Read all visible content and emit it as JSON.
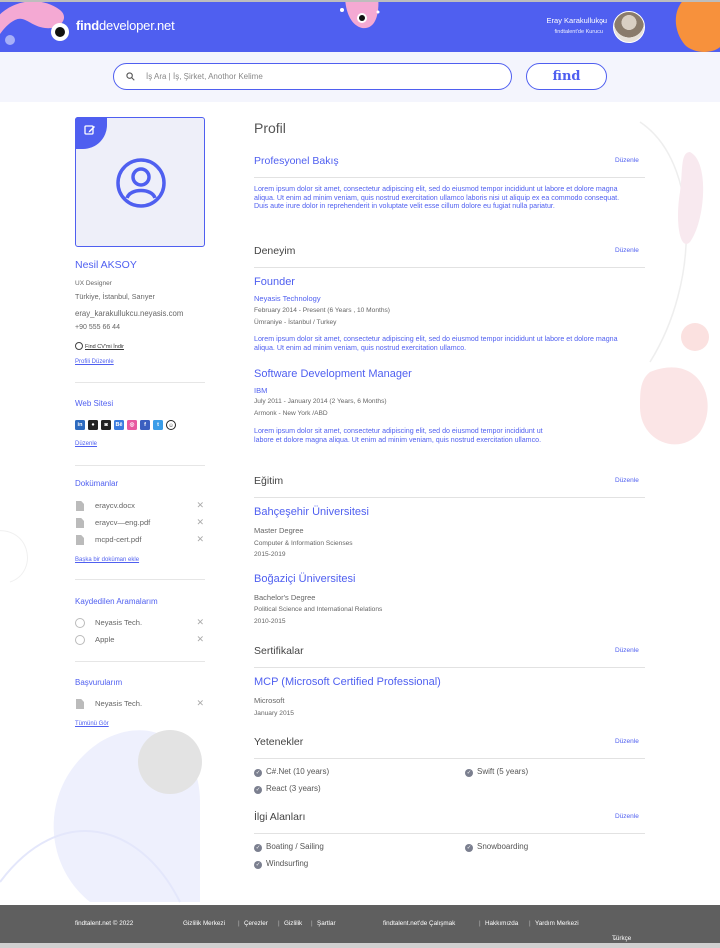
{
  "brand": {
    "logo_find": "find",
    "logo_rest": "developer.net"
  },
  "user": {
    "name": "Eray Karakullukçu",
    "subtitle": "findtalent'de Kurucu"
  },
  "search": {
    "placeholder": "İş Ara  |  İş, Şirket, Anothor Kelime",
    "button": "find"
  },
  "profile": {
    "name": "Nesil AKSOY",
    "title": "UX Designer",
    "location": "Türkiye, İstanbul, Sarıyer",
    "email": "eray_karakullukcu.neyasis.com",
    "phone": "+90 555 66 44",
    "cv_link": "Find CV'mi İndir",
    "edit_link": "Profili Düzenle"
  },
  "website": {
    "heading": "Web Sitesi",
    "icons": [
      "linkedin-icon",
      "github-icon",
      "dribbble-icon",
      "behance-icon",
      "instagram-icon",
      "facebook-icon",
      "twitter-icon",
      "reddit-icon"
    ],
    "edit": "Düzenle"
  },
  "documents": {
    "heading": "Dokümanlar",
    "items": [
      "eraycv.docx",
      "eraycv—eng.pdf",
      "mcpd-cert.pdf"
    ],
    "add_link": "Başka bir doküman ekle"
  },
  "saved_searches": {
    "heading": "Kaydedilen Aramalarım",
    "items": [
      "Neyasis Tech.",
      "Apple"
    ]
  },
  "applications": {
    "heading": "Başvurularım",
    "items": [
      "Neyasis Tech."
    ],
    "all_link": "Tümünü Gör"
  },
  "main": {
    "page_title": "Profil",
    "edit_label": "Düzenle",
    "overview": {
      "heading": "Profesyonel Bakış",
      "text": "Lorem ipsum dolor sit amet, consectetur adipiscing elit, sed do eiusmod tempor incididunt ut labore et dolore magna aliqua. Ut enim ad minim veniam, quis nostrud exercitation ullamco laboris nisi ut aliquip ex ea commodo consequat. Duis aute irure dolor in reprehenderit in voluptate velit esse cillum dolore eu fugiat nulla pariatur."
    },
    "experience": {
      "heading": "Deneyim",
      "items": [
        {
          "role": "Founder",
          "company": "Neyasis Technology",
          "dates": "February 2014 - Present (6 Years , 10 Months)",
          "location": "Ümraniye - İstanbul / Turkey",
          "text": "Lorem ipsum dolor sit amet, consectetur adipiscing elit, sed do eiusmod tempor incididunt ut labore et dolore magna aliqua. Ut enim ad minim veniam, quis nostrud exercitation ullamco."
        },
        {
          "role": "Software Development Manager",
          "company": "IBM",
          "dates": "July 2011 - January 2014  (2 Years, 6 Months)",
          "location": "Armonk - New York /ABD",
          "text": "Lorem ipsum dolor sit amet, consectetur adipiscing elit, sed do eiusmod tempor incididunt ut labore et dolore magna aliqua. Ut enim ad minim veniam, quis nostrud exercitation ullamco."
        }
      ]
    },
    "education": {
      "heading": "Eğitim",
      "items": [
        {
          "school": "Bahçeşehir Üniversitesi",
          "degree": "Master Degree",
          "field": "Computer & Information Scienses",
          "years": "2015-2019"
        },
        {
          "school": "Boğaziçi Üniversitesi",
          "degree": "Bachelor's Degree",
          "field": "Political Science and International Relations",
          "years": "2010-2015"
        }
      ]
    },
    "certificates": {
      "heading": "Sertifikalar",
      "items": [
        {
          "name": "MCP (Microsoft Certified Professional)",
          "issuer": "Microsoft",
          "date": "January 2015"
        }
      ]
    },
    "skills": {
      "heading": "Yetenekler",
      "items": [
        "C#.Net (10 years)",
        "Swift (5 years)",
        "React (3 years)"
      ]
    },
    "interests": {
      "heading": "İlgi Alanları",
      "items": [
        "Boating / Sailing",
        "Snowboarding",
        "Windsurfing"
      ]
    }
  },
  "footer": {
    "copyright": "findtalent.net © 2022",
    "links_left": [
      "Gizlilik Merkezi",
      "Çerezler",
      "Gizlilik",
      "Şartlar"
    ],
    "links_right": [
      "findtalent.net'de Çalışmak",
      "Hakkımızda",
      "Yardım Merkezi"
    ],
    "language": "Türkçe"
  },
  "colors": {
    "primary": "#4f5ff0",
    "footer": "#5f5f5f",
    "accent_pink": "#f4a9d3",
    "accent_orange": "#f7913c"
  }
}
